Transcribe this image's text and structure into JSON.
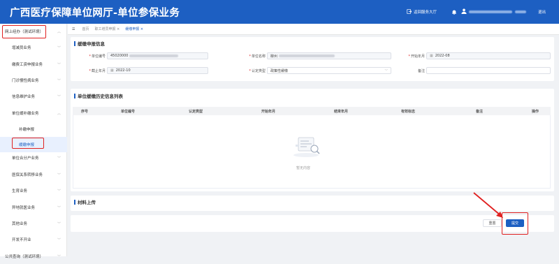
{
  "header": {
    "title": "广西医疗保障单位网厅-单位参保业务",
    "back_label": "返回服务大厅",
    "logout_label": "退出"
  },
  "sidebar": {
    "top_item": "网上经办（测试环境）",
    "items": [
      {
        "label": "增减员业务",
        "chevron": "﹀"
      },
      {
        "label": "缴费工资申报业务",
        "chevron": "﹀"
      },
      {
        "label": "门诊慢性病业务",
        "chevron": "﹀"
      },
      {
        "label": "信息维护业务",
        "chevron": "﹀"
      },
      {
        "label": "单位缓补缴业务",
        "chevron": "︿"
      },
      {
        "label": "补缴申报",
        "chevron": ""
      },
      {
        "label": "缓缴申报",
        "chevron": ""
      },
      {
        "label": "单位合分户业务",
        "chevron": "﹀"
      },
      {
        "label": "医保关系转移业务",
        "chevron": "﹀"
      },
      {
        "label": "生育业务",
        "chevron": "﹀"
      },
      {
        "label": "异地就医业务",
        "chevron": "﹀"
      },
      {
        "label": "其他业务",
        "chevron": "﹀"
      },
      {
        "label": "开发不开业",
        "chevron": "﹀"
      },
      {
        "label": "公共查询（测试环境）",
        "chevron": "﹀"
      }
    ]
  },
  "tabs": {
    "menu_icon": "☰",
    "home": "首页",
    "tab1": "职工增员申报",
    "tab2": "缓缴申报",
    "close": "×"
  },
  "form": {
    "section_title": "缓缴申报信息",
    "unit_no_label": "单位编号",
    "unit_no_value": "45020000",
    "unit_name_label": "单位名称",
    "unit_name_value": "柳州",
    "start_label": "开始年月",
    "start_value": "2022-08",
    "end_label": "截止年月",
    "end_value": "2022-10",
    "type_label": "认定类型",
    "type_value": "政策性缓缴",
    "remark_label": "备注",
    "required_mark": "*"
  },
  "history": {
    "section_title": "单位缓缴历史信息列表",
    "columns": [
      "序号",
      "单位编号",
      "认定类型",
      "开始年月",
      "结束年月",
      "有效标志",
      "备注",
      "操作"
    ],
    "empty_text": "暂无内容"
  },
  "materials": {
    "section_title": "材料上传"
  },
  "actions": {
    "reset_label": "重置",
    "submit_label": "提交"
  },
  "colors": {
    "brand": "#1d5fc2",
    "highlight": "#e02020"
  }
}
